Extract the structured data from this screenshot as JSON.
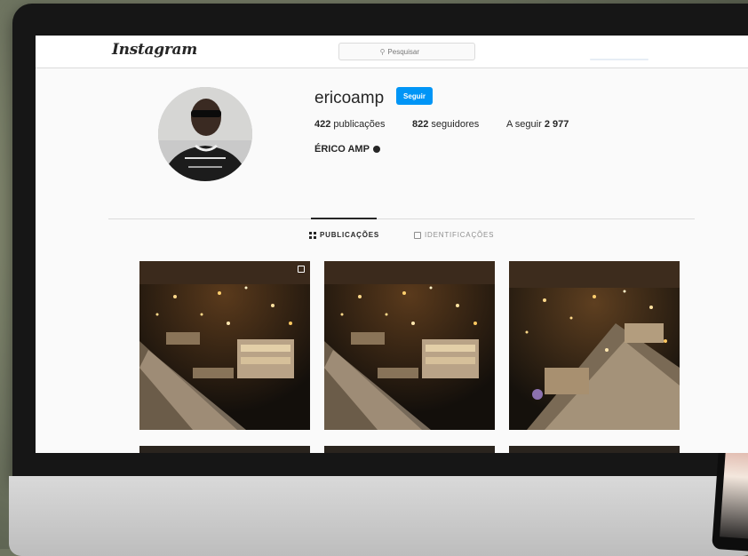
{
  "app": {
    "logo": "Instagram",
    "search": {
      "placeholder": "Pesquisar",
      "value": ""
    }
  },
  "profile": {
    "username": "ericoamp",
    "follow_label": "Seguir",
    "stats": {
      "posts_count": "422",
      "posts_label": "publicações",
      "followers_count": "822",
      "followers_label": "seguidores",
      "following_label": "A seguir",
      "following_count": "2 977"
    },
    "full_name": "ÉRICO AMP"
  },
  "tabs": [
    {
      "label": "PUBLICAÇÕES",
      "icon": "grid-icon",
      "active": true
    },
    {
      "label": "IDENTIFICAÇÕES",
      "icon": "tag-icon",
      "active": false
    }
  ],
  "colors": {
    "accent": "#0095f6",
    "text": "#262626",
    "muted": "#8e8e8e",
    "border": "#dbdbdb"
  },
  "posts": [
    {
      "type": "carousel",
      "icon": "multiple-images-icon"
    },
    {
      "type": "image"
    },
    {
      "type": "image"
    }
  ]
}
